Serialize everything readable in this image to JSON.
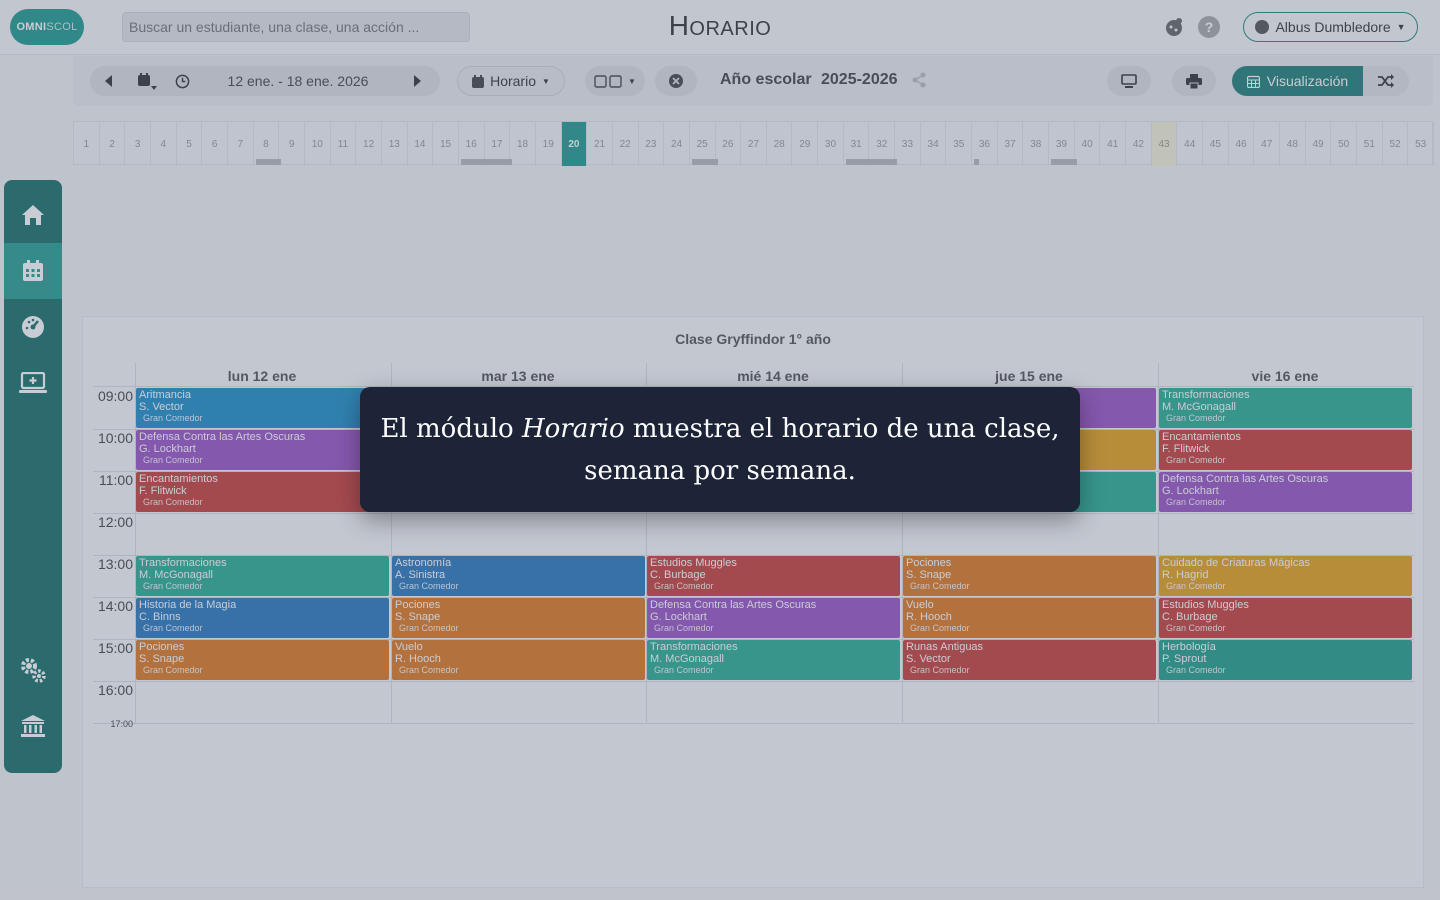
{
  "header": {
    "logo_text": "OMNI",
    "logo_text2": "SCOL",
    "search_placeholder": "Buscar un estudiante, una clase, una acción ...",
    "title": "Horario",
    "user_name": "Albus Dumbledore"
  },
  "toolbar": {
    "date_range": "12 ene. - 18 ene. 2026",
    "view_select": "Horario",
    "year_label": "Año escolar",
    "year_value": "2025-2026",
    "visualization_label": "Visualización"
  },
  "weeks": [
    "1",
    "2",
    "3",
    "4",
    "5",
    "6",
    "7",
    "8",
    "9",
    "10",
    "11",
    "12",
    "13",
    "14",
    "15",
    "16",
    "17",
    "18",
    "19",
    "20",
    "21",
    "22",
    "23",
    "24",
    "25",
    "26",
    "27",
    "28",
    "29",
    "30",
    "31",
    "32",
    "33",
    "34",
    "35",
    "36",
    "37",
    "38",
    "39",
    "40",
    "41",
    "42",
    "43",
    "44",
    "45",
    "46",
    "47",
    "48",
    "49",
    "50",
    "51",
    "52",
    "53"
  ],
  "current_week": "20",
  "highlight_week": "43",
  "sidebar": [
    "home-icon",
    "calendar-icon",
    "dashboard-icon",
    "monitor-plus-icon",
    "gears-icon",
    "institution-icon"
  ],
  "schedule": {
    "class_title": "Clase Gryffindor 1° año",
    "days": [
      "lun 12 ene",
      "mar 13 ene",
      "mié 14 ene",
      "jue 15 ene",
      "vie 16 ene"
    ],
    "times": [
      "09:00",
      "10:00",
      "11:00",
      "12:00",
      "13:00",
      "14:00",
      "15:00",
      "16:00"
    ],
    "end_time": "17:00",
    "events": [
      {
        "day": 0,
        "slot": 0,
        "subject": "Aritmancia",
        "teacher": "S. Vector",
        "room": "Gran Comedor",
        "color": "#1f8fc9"
      },
      {
        "day": 0,
        "slot": 1,
        "subject": "Defensa Contra las Artes Oscuras",
        "teacher": "G. Lockhart",
        "room": "Gran Comedor",
        "color": "#9b54c6"
      },
      {
        "day": 0,
        "slot": 2,
        "subject": "Encantamientos",
        "teacher": "F. Flitwick",
        "room": "Gran Comedor",
        "color": "#c9403a"
      },
      {
        "day": 0,
        "slot": 4,
        "subject": "Transformaciones",
        "teacher": "M. McGonagall",
        "room": "Gran Comedor",
        "color": "#2aae96"
      },
      {
        "day": 0,
        "slot": 5,
        "subject": "Historia de la Magia",
        "teacher": "C. Binns",
        "room": "Gran Comedor",
        "color": "#2a79bd"
      },
      {
        "day": 0,
        "slot": 6,
        "subject": "Pociones",
        "teacher": "S. Snape",
        "room": "Gran Comedor",
        "color": "#e07a22"
      },
      {
        "day": 1,
        "slot": 4,
        "subject": "Astronomía",
        "teacher": "A. Sinistra",
        "room": "Gran Comedor",
        "color": "#2a79bd"
      },
      {
        "day": 1,
        "slot": 5,
        "subject": "Pociones",
        "teacher": "S. Snape",
        "room": "Gran Comedor",
        "color": "#e07a22"
      },
      {
        "day": 1,
        "slot": 6,
        "subject": "Vuelo",
        "teacher": "R. Hooch",
        "room": "Gran Comedor",
        "color": "#e07a22"
      },
      {
        "day": 2,
        "slot": 4,
        "subject": "Estudios Muggles",
        "teacher": "C. Burbage",
        "room": "Gran Comedor",
        "color": "#c9403a"
      },
      {
        "day": 2,
        "slot": 5,
        "subject": "Defensa Contra las Artes Oscuras",
        "teacher": "G. Lockhart",
        "room": "Gran Comedor",
        "color": "#9b54c6"
      },
      {
        "day": 2,
        "slot": 6,
        "subject": "Transformaciones",
        "teacher": "M. McGonagall",
        "room": "Gran Comedor",
        "color": "#2aae96"
      },
      {
        "day": 3,
        "slot": 4,
        "subject": "Pociones",
        "teacher": "S. Snape",
        "room": "Gran Comedor",
        "color": "#e07a22"
      },
      {
        "day": 3,
        "slot": 5,
        "subject": "Vuelo",
        "teacher": "R. Hooch",
        "room": "Gran Comedor",
        "color": "#e07a22"
      },
      {
        "day": 3,
        "slot": 6,
        "subject": "Runas Antiguas",
        "teacher": "S. Vector",
        "room": "Gran Comedor",
        "color": "#c9403a"
      },
      {
        "day": 4,
        "slot": 0,
        "subject": "Transformaciones",
        "teacher": "M. McGonagall",
        "room": "Gran Comedor",
        "color": "#2aae96"
      },
      {
        "day": 4,
        "slot": 1,
        "subject": "Encantamientos",
        "teacher": "F. Flitwick",
        "room": "Gran Comedor",
        "color": "#c9403a"
      },
      {
        "day": 4,
        "slot": 2,
        "subject": "Defensa Contra las Artes Oscuras",
        "teacher": "G. Lockhart",
        "room": "Gran Comedor",
        "color": "#9b54c6"
      },
      {
        "day": 4,
        "slot": 4,
        "subject": "Cuidado de Criaturas Mágicas",
        "teacher": "R. Hagrid",
        "room": "Gran Comedor",
        "color": "#e6a21c"
      },
      {
        "day": 4,
        "slot": 5,
        "subject": "Estudios Muggles",
        "teacher": "C. Burbage",
        "room": "Gran Comedor",
        "color": "#c9403a"
      },
      {
        "day": 4,
        "slot": 6,
        "subject": "Herbología",
        "teacher": "P. Sprout",
        "room": "Gran Comedor",
        "color": "#23a08a"
      }
    ],
    "hidden_events": [
      {
        "day": 3,
        "slot": 0,
        "color": "#9b54c6"
      },
      {
        "day": 3,
        "slot": 1,
        "color": "#e6a21c"
      },
      {
        "day": 3,
        "slot": 2,
        "color": "#2aae96"
      }
    ]
  },
  "tooltip": {
    "prefix": "El módulo ",
    "module": "Horario",
    "suffix": " muestra el horario de una clase, semana por semana."
  }
}
